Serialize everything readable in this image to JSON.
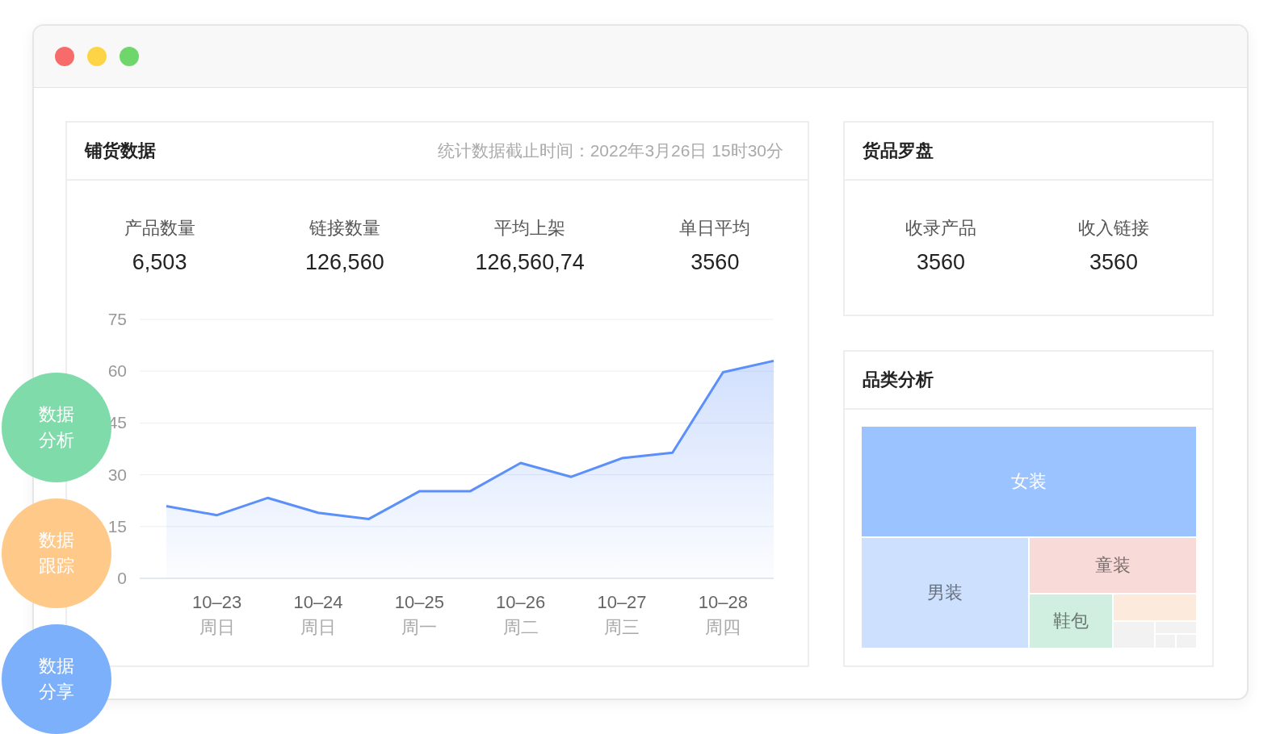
{
  "window": {
    "controls": [
      {
        "color": "#f76b6b"
      },
      {
        "color": "#fdd446"
      },
      {
        "color": "#6fd66b"
      }
    ]
  },
  "distribution": {
    "title": "铺货数据",
    "timestamp": "统计数据截止时间：2022年3月26日 15时30分",
    "stats": [
      {
        "label": "产品数量",
        "value": "6,503"
      },
      {
        "label": "链接数量",
        "value": "126,560"
      },
      {
        "label": "平均上架",
        "value": "126,560,74"
      },
      {
        "label": "单日平均",
        "value": "3560"
      }
    ],
    "chart_data": {
      "type": "area",
      "grid": true,
      "ylim": [
        0,
        75
      ],
      "yticks": [
        0,
        15,
        30,
        45,
        60,
        75
      ],
      "categories": [
        null,
        "10–23\n周日",
        null,
        "10–24\n周日",
        null,
        "10–25\n周一",
        null,
        "10–26\n周二",
        null,
        "10–27\n周三",
        null,
        "10–28\n周四",
        null
      ],
      "series": [
        {
          "color": "#5b8ff9",
          "values": [
            20.9,
            18.3,
            23.3,
            19,
            17.2,
            25.2,
            25.2,
            33.4,
            29.4,
            34.8,
            36.4,
            59.7,
            63
          ]
        }
      ]
    }
  },
  "compass": {
    "title": "货品罗盘",
    "stats": [
      {
        "label": "收录产品",
        "value": "3560"
      },
      {
        "label": "收入链接",
        "value": "3560"
      }
    ]
  },
  "category": {
    "title": "品类分析",
    "tiles": [
      {
        "label": "女装",
        "color": "#9bc3ff"
      },
      {
        "label": "男装",
        "color": "#cde0fe"
      },
      {
        "label": "童装",
        "color": "#f8dbd9"
      },
      {
        "label": "鞋包",
        "color": "#d0efe0"
      },
      {
        "color": "#fcebdc"
      },
      {
        "color": "#f2f2f2"
      },
      {
        "color": "#f2f2f2"
      },
      {
        "color": "#f2f2f2"
      },
      {
        "color": "#f2f2f2"
      }
    ]
  },
  "side_buttons": [
    {
      "label": "数据分析",
      "color": "#7fdcaa"
    },
    {
      "label": "数据跟踪",
      "color": "#ffc98a"
    },
    {
      "label": "数据分享",
      "color": "#7cb0fa"
    }
  ]
}
